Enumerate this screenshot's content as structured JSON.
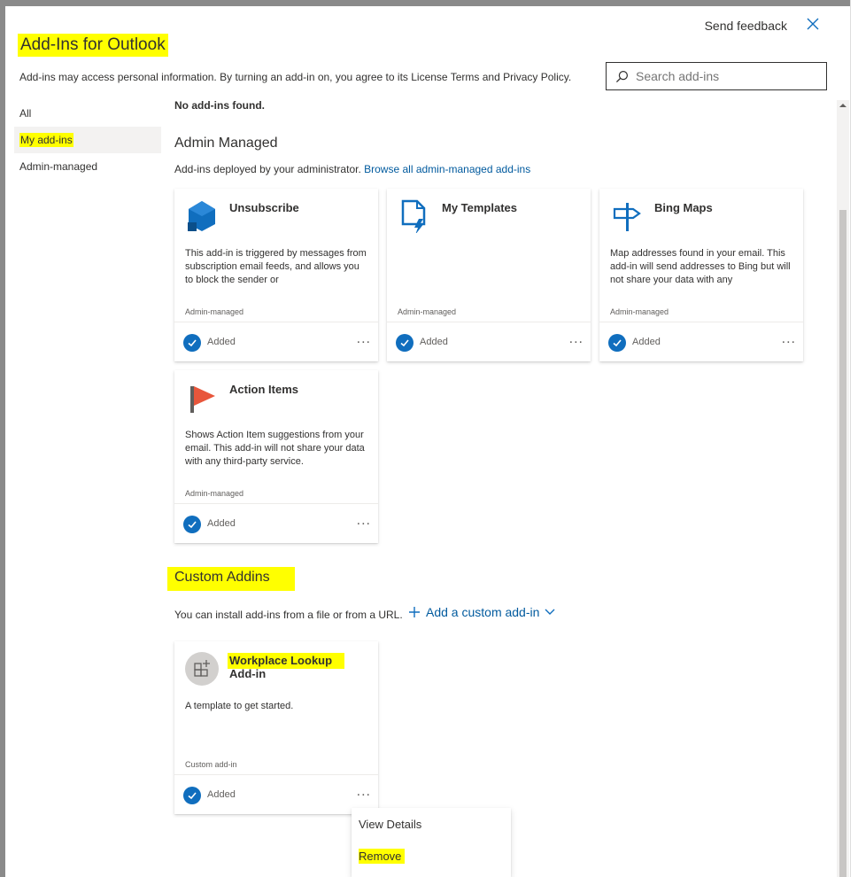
{
  "header": {
    "title": "Add-Ins for Outlook",
    "feedback_label": "Send feedback",
    "subtitle": "Add-ins may access personal information. By turning an add-in on, you agree to its License Terms and Privacy Policy."
  },
  "search": {
    "placeholder": "Search add-ins"
  },
  "nav": {
    "items": [
      {
        "label": "All"
      },
      {
        "label": "My add-ins"
      },
      {
        "label": "Admin-managed"
      }
    ]
  },
  "main": {
    "no_found": "No add-ins found.",
    "admin": {
      "title": "Admin Managed",
      "desc": "Add-ins deployed by your administrator.",
      "link": "Browse all admin-managed add-ins",
      "cards": [
        {
          "name": "Unsubscribe",
          "desc": "This add-in is triggered by messages from subscription email feeds, and allows you to block the sender or",
          "tag": "Admin-managed",
          "status": "Added",
          "more": "..."
        },
        {
          "name": "My Templates",
          "desc": "",
          "tag": "Admin-managed",
          "status": "Added",
          "more": "..."
        },
        {
          "name": "Bing Maps",
          "desc": "Map addresses found in your email. This add-in will send addresses to Bing but will not share your data with any",
          "tag": "Admin-managed",
          "status": "Added",
          "more": "..."
        },
        {
          "name": "Action Items",
          "desc": "Shows Action Item suggestions from your email. This add-in will not share your data with any third-party service.",
          "tag": "Admin-managed",
          "status": "Added",
          "more": "..."
        }
      ]
    },
    "custom": {
      "title": "Custom Addins",
      "desc": "You can install add-ins from a file or from a URL.",
      "add_label": "Add a custom add-in",
      "cards": [
        {
          "name_line1": "Workplace Lookup",
          "name_line2": "Add-in",
          "desc": "A template to get started.",
          "tag": "Custom add-in",
          "status": "Added",
          "more": "..."
        }
      ]
    }
  },
  "context_menu": {
    "items": [
      {
        "label": "View Details"
      },
      {
        "label": "Remove"
      }
    ]
  },
  "colors": {
    "highlight": "#ffff00",
    "accent": "#106ebe",
    "link": "#005a9e",
    "flag": "#e8563b"
  }
}
